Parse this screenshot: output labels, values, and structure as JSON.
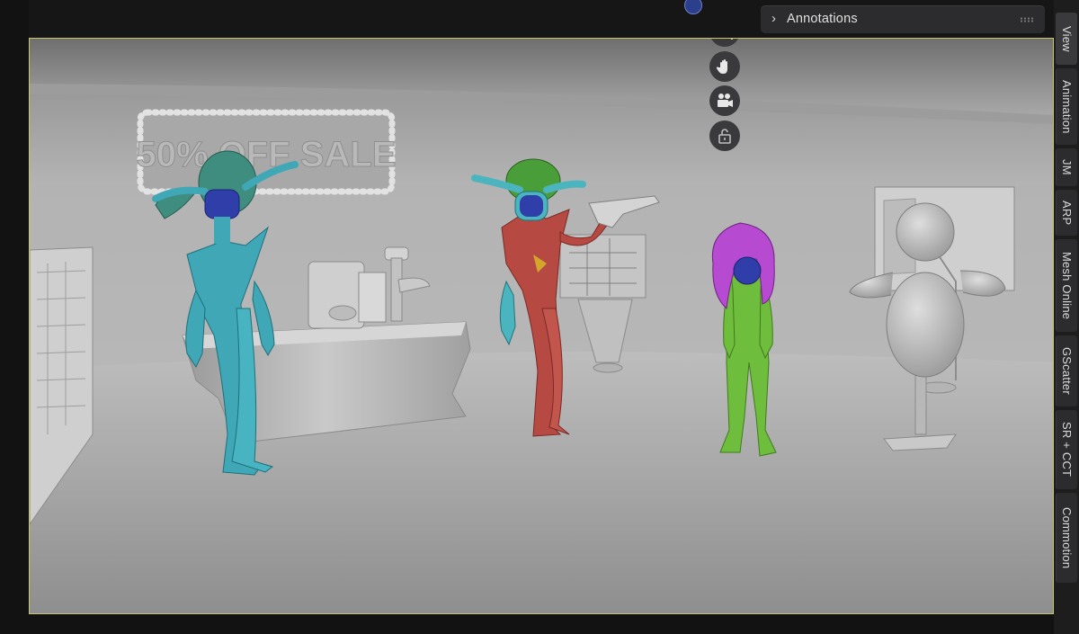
{
  "panel": {
    "annotations_label": "Annotations"
  },
  "viewport": {
    "sign_text": "50% OFF SALE"
  },
  "nav_tools": [
    {
      "name": "zoom-icon"
    },
    {
      "name": "hand-pan-icon"
    },
    {
      "name": "camera-view-icon"
    },
    {
      "name": "lock-icon"
    }
  ],
  "sidebar": {
    "tabs": [
      {
        "label": "View",
        "active": true
      },
      {
        "label": "Animation"
      },
      {
        "label": "JM"
      },
      {
        "label": "ARP"
      },
      {
        "label": "Mesh Online"
      },
      {
        "label": "GScatter"
      },
      {
        "label": "SR + CCT"
      },
      {
        "label": "Commotion"
      }
    ]
  },
  "colors": {
    "teal_character": "#3fa7b6",
    "red_character": "#b64a42",
    "green_character": "#6fbd3c",
    "pink_hair": "#b64ad0",
    "face_blue": "#2f3ea8",
    "viewport_border": "#c7c76a"
  }
}
